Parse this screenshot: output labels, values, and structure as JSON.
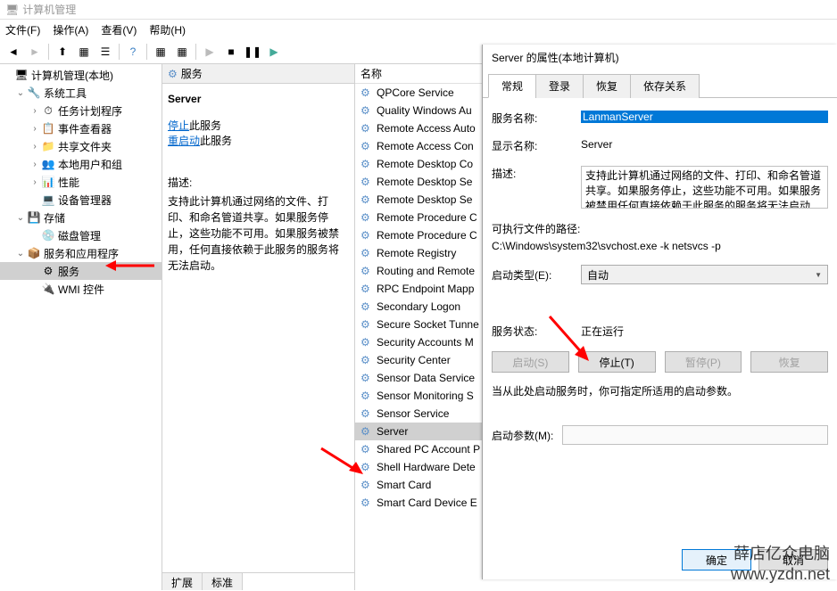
{
  "window": {
    "title": "计算机管理"
  },
  "menu": {
    "file": "文件(F)",
    "action": "操作(A)",
    "view": "查看(V)",
    "help": "帮助(H)"
  },
  "tree": {
    "root": "计算机管理(本地)",
    "n1": "系统工具",
    "n1a": "任务计划程序",
    "n1b": "事件查看器",
    "n1c": "共享文件夹",
    "n1d": "本地用户和组",
    "n1e": "性能",
    "n1f": "设备管理器",
    "n2": "存储",
    "n2a": "磁盘管理",
    "n3": "服务和应用程序",
    "n3a": "服务",
    "n3b": "WMI 控件"
  },
  "mid": {
    "header": "服务",
    "title": "Server",
    "stop": "停止",
    "stop_suffix": "此服务",
    "restart": "重启动",
    "restart_suffix": "此服务",
    "desc_head": "描述:",
    "desc": "支持此计算机通过网络的文件、打印、和命名管道共享。如果服务停止，这些功能不可用。如果服务被禁用，任何直接依赖于此服务的服务将无法启动。",
    "tab1": "扩展",
    "tab2": "标准"
  },
  "svc_header": "名称",
  "services": [
    "QPCore Service",
    "Quality Windows Au",
    "Remote Access Auto",
    "Remote Access Con",
    "Remote Desktop Co",
    "Remote Desktop Se",
    "Remote Desktop Se",
    "Remote Procedure C",
    "Remote Procedure C",
    "Remote Registry",
    "Routing and Remote",
    "RPC Endpoint Mapp",
    "Secondary Logon",
    "Secure Socket Tunne",
    "Security Accounts M",
    "Security Center",
    "Sensor Data Service",
    "Sensor Monitoring S",
    "Sensor Service",
    "Server",
    "Shared PC Account P",
    "Shell Hardware Dete",
    "Smart Card",
    "Smart Card Device E"
  ],
  "dialog": {
    "title": "Server 的属性(本地计算机)",
    "tabs": {
      "general": "常规",
      "logon": "登录",
      "recovery": "恢复",
      "depend": "依存关系"
    },
    "svc_name_lbl": "服务名称:",
    "svc_name": "LanmanServer",
    "disp_name_lbl": "显示名称:",
    "disp_name": "Server",
    "desc_lbl": "描述:",
    "desc": "支持此计算机通过网络的文件、打印、和命名管道共享。如果服务停止，这些功能不可用。如果服务被禁用任何直接依赖于此服务的服务将无法启动",
    "path_lbl": "可执行文件的路径:",
    "path": "C:\\Windows\\system32\\svchost.exe -k netsvcs -p",
    "startup_lbl": "启动类型(E):",
    "startup": "自动",
    "status_lbl": "服务状态:",
    "status": "正在运行",
    "btn_start": "启动(S)",
    "btn_stop": "停止(T)",
    "btn_pause": "暂停(P)",
    "btn_resume": "恢复",
    "param_hint": "当从此处启动服务时，你可指定所适用的启动参数。",
    "param_lbl": "启动参数(M):",
    "ok": "确定",
    "cancel": "取消"
  },
  "watermark": "www.yzdn.net",
  "watermark2": "薛店亿众电脑"
}
